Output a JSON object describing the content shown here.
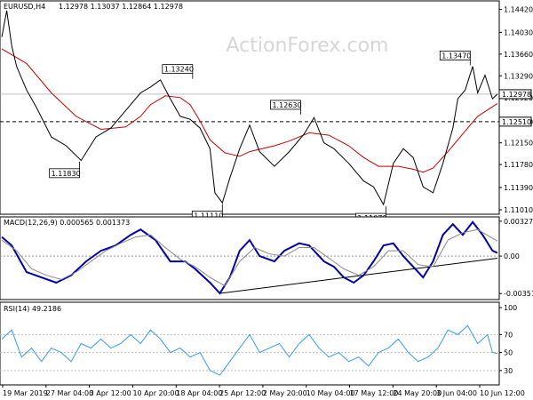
{
  "watermark": "ActionForex.com",
  "chart_data": [
    {
      "type": "candlestick",
      "title": "EURUSD,H4",
      "header_values": "1.12978 1.13037 1.12864 1.12978",
      "ylim": [
        1.1095,
        1.1455
      ],
      "y_ticks": [
        "1.14420",
        "1.14030",
        "1.13660",
        "1.13290",
        "1.12920",
        "1.12510",
        "1.12150",
        "1.11780",
        "1.11390",
        "1.11010"
      ],
      "y_tick_values": [
        1.1442,
        1.1403,
        1.1366,
        1.1329,
        1.1292,
        1.1251,
        1.1215,
        1.1178,
        1.1139,
        1.1101
      ],
      "current_price": "1.12978",
      "current_price_value": 1.12978,
      "level_line": "1.12510",
      "level_line_value": 1.1251,
      "annotations": [
        {
          "text": "1.13240",
          "x": 0.385,
          "value": 1.1324
        },
        {
          "text": "1.11830",
          "x": 0.157,
          "value": 1.1183
        },
        {
          "text": "1.12630",
          "x": 0.603,
          "value": 1.1263
        },
        {
          "text": "1.11110",
          "x": 0.445,
          "value": 1.1111
        },
        {
          "text": "1.11070",
          "x": 0.775,
          "value": 1.1107
        },
        {
          "text": "1.13470",
          "x": 0.945,
          "value": 1.1347
        }
      ],
      "series": [
        {
          "legend": false,
          "color": "#cc0000",
          "points": [
            [
              0,
              1.1375
            ],
            [
              0.05,
              1.135
            ],
            [
              0.1,
              1.13
            ],
            [
              0.15,
              1.126
            ],
            [
              0.2,
              1.1238
            ],
            [
              0.25,
              1.1242
            ],
            [
              0.28,
              1.126
            ],
            [
              0.3,
              1.128
            ],
            [
              0.33,
              1.1295
            ],
            [
              0.36,
              1.1292
            ],
            [
              0.38,
              1.128
            ],
            [
              0.4,
              1.1252
            ],
            [
              0.42,
              1.122
            ],
            [
              0.45,
              1.1198
            ],
            [
              0.48,
              1.1192
            ],
            [
              0.5,
              1.12
            ],
            [
              0.55,
              1.121
            ],
            [
              0.58,
              1.1218
            ],
            [
              0.62,
              1.1232
            ],
            [
              0.66,
              1.1228
            ],
            [
              0.7,
              1.121
            ],
            [
              0.73,
              1.119
            ],
            [
              0.76,
              1.1175
            ],
            [
              0.8,
              1.1175
            ],
            [
              0.83,
              1.117
            ],
            [
              0.85,
              1.1165
            ],
            [
              0.87,
              1.1172
            ],
            [
              0.9,
              1.12
            ],
            [
              0.93,
              1.123
            ],
            [
              0.96,
              1.126
            ],
            [
              1.0,
              1.1282
            ]
          ]
        },
        {
          "legend": false,
          "color": "#000000",
          "points": [
            [
              0,
              1.1395
            ],
            [
              0.01,
              1.144
            ],
            [
              0.02,
              1.138
            ],
            [
              0.03,
              1.1345
            ],
            [
              0.05,
              1.1305
            ],
            [
              0.07,
              1.1275
            ],
            [
              0.1,
              1.1225
            ],
            [
              0.13,
              1.121
            ],
            [
              0.16,
              1.1185
            ],
            [
              0.19,
              1.1225
            ],
            [
              0.22,
              1.124
            ],
            [
              0.25,
              1.127
            ],
            [
              0.28,
              1.13
            ],
            [
              0.3,
              1.131
            ],
            [
              0.32,
              1.1322
            ],
            [
              0.34,
              1.129
            ],
            [
              0.36,
              1.126
            ],
            [
              0.38,
              1.1255
            ],
            [
              0.4,
              1.124
            ],
            [
              0.42,
              1.1205
            ],
            [
              0.43,
              1.113
            ],
            [
              0.445,
              1.1113
            ],
            [
              0.46,
              1.1155
            ],
            [
              0.48,
              1.1205
            ],
            [
              0.5,
              1.1245
            ],
            [
              0.52,
              1.12
            ],
            [
              0.55,
              1.1175
            ],
            [
              0.58,
              1.12
            ],
            [
              0.61,
              1.123
            ],
            [
              0.63,
              1.1258
            ],
            [
              0.65,
              1.1215
            ],
            [
              0.67,
              1.1205
            ],
            [
              0.7,
              1.118
            ],
            [
              0.73,
              1.115
            ],
            [
              0.75,
              1.114
            ],
            [
              0.77,
              1.111
            ],
            [
              0.79,
              1.118
            ],
            [
              0.81,
              1.1205
            ],
            [
              0.83,
              1.119
            ],
            [
              0.85,
              1.114
            ],
            [
              0.87,
              1.113
            ],
            [
              0.89,
              1.118
            ],
            [
              0.91,
              1.124
            ],
            [
              0.92,
              1.129
            ],
            [
              0.935,
              1.1305
            ],
            [
              0.95,
              1.1345
            ],
            [
              0.96,
              1.13
            ],
            [
              0.975,
              1.133
            ],
            [
              0.99,
              1.129
            ],
            [
              1.0,
              1.1298
            ]
          ]
        }
      ]
    },
    {
      "type": "line",
      "title": "MACD(12,26,9) 0.000565 0.001373",
      "ylim": [
        -0.004,
        0.0036
      ],
      "y_ticks": [
        "0.003278",
        "0.00",
        "-0.003519"
      ],
      "y_tick_values": [
        0.003278,
        0.0,
        -0.003519
      ],
      "trendline": [
        [
          0.44,
          -0.0035
        ],
        [
          1.0,
          -0.0002
        ]
      ],
      "series": [
        {
          "color": "#0000aa",
          "points": [
            [
              0,
              0.0018
            ],
            [
              0.02,
              0.001
            ],
            [
              0.05,
              -0.0015
            ],
            [
              0.08,
              -0.002
            ],
            [
              0.11,
              -0.0025
            ],
            [
              0.14,
              -0.0018
            ],
            [
              0.17,
              -0.0005
            ],
            [
              0.2,
              0.0005
            ],
            [
              0.23,
              0.001
            ],
            [
              0.26,
              0.002
            ],
            [
              0.28,
              0.0025
            ],
            [
              0.31,
              0.0015
            ],
            [
              0.34,
              -0.0005
            ],
            [
              0.37,
              -0.0005
            ],
            [
              0.39,
              -0.0012
            ],
            [
              0.42,
              -0.0025
            ],
            [
              0.44,
              -0.0035
            ],
            [
              0.46,
              -0.002
            ],
            [
              0.48,
              0.0005
            ],
            [
              0.5,
              0.0015
            ],
            [
              0.52,
              0.0
            ],
            [
              0.55,
              -0.0005
            ],
            [
              0.57,
              0.0005
            ],
            [
              0.6,
              0.0012
            ],
            [
              0.62,
              0.001
            ],
            [
              0.65,
              -0.0005
            ],
            [
              0.67,
              -0.001
            ],
            [
              0.69,
              -0.002
            ],
            [
              0.71,
              -0.0025
            ],
            [
              0.73,
              -0.0018
            ],
            [
              0.75,
              -0.0005
            ],
            [
              0.77,
              0.001
            ],
            [
              0.79,
              0.0012
            ],
            [
              0.81,
              0.0
            ],
            [
              0.83,
              -0.001
            ],
            [
              0.85,
              -0.002
            ],
            [
              0.87,
              -0.0005
            ],
            [
              0.89,
              0.002
            ],
            [
              0.91,
              0.003
            ],
            [
              0.93,
              0.002
            ],
            [
              0.95,
              0.0032
            ],
            [
              0.97,
              0.002
            ],
            [
              0.99,
              0.0005
            ],
            [
              1.0,
              0.0003
            ]
          ]
        },
        {
          "color": "#888888",
          "points": [
            [
              0,
              0.0015
            ],
            [
              0.03,
              0.0005
            ],
            [
              0.06,
              -0.0012
            ],
            [
              0.09,
              -0.0018
            ],
            [
              0.12,
              -0.0022
            ],
            [
              0.15,
              -0.0015
            ],
            [
              0.18,
              -0.0005
            ],
            [
              0.21,
              0.0005
            ],
            [
              0.24,
              0.0012
            ],
            [
              0.27,
              0.0018
            ],
            [
              0.3,
              0.002
            ],
            [
              0.33,
              0.0008
            ],
            [
              0.36,
              -0.0003
            ],
            [
              0.39,
              -0.001
            ],
            [
              0.42,
              -0.002
            ],
            [
              0.45,
              -0.0028
            ],
            [
              0.48,
              -0.0005
            ],
            [
              0.51,
              0.0008
            ],
            [
              0.54,
              0.0002
            ],
            [
              0.57,
              0.0
            ],
            [
              0.6,
              0.0008
            ],
            [
              0.63,
              0.0008
            ],
            [
              0.66,
              -0.0002
            ],
            [
              0.69,
              -0.0012
            ],
            [
              0.72,
              -0.0018
            ],
            [
              0.75,
              -0.001
            ],
            [
              0.78,
              0.0005
            ],
            [
              0.81,
              0.0005
            ],
            [
              0.84,
              -0.0008
            ],
            [
              0.87,
              -0.001
            ],
            [
              0.9,
              0.0015
            ],
            [
              0.93,
              0.0022
            ],
            [
              0.96,
              0.0025
            ],
            [
              1.0,
              0.0014
            ]
          ]
        }
      ]
    },
    {
      "type": "line",
      "title": "RSI(14) 49.2186",
      "ylim": [
        15,
        105
      ],
      "y_ticks": [
        "100",
        "70",
        "50",
        "30"
      ],
      "y_tick_values": [
        100,
        70,
        50,
        30
      ],
      "series": [
        {
          "color": "#3399ff",
          "points": [
            [
              0,
              65
            ],
            [
              0.02,
              75
            ],
            [
              0.04,
              45
            ],
            [
              0.06,
              55
            ],
            [
              0.08,
              40
            ],
            [
              0.1,
              55
            ],
            [
              0.12,
              50
            ],
            [
              0.14,
              40
            ],
            [
              0.16,
              60
            ],
            [
              0.18,
              55
            ],
            [
              0.2,
              65
            ],
            [
              0.22,
              55
            ],
            [
              0.24,
              60
            ],
            [
              0.26,
              70
            ],
            [
              0.28,
              60
            ],
            [
              0.3,
              75
            ],
            [
              0.32,
              65
            ],
            [
              0.34,
              50
            ],
            [
              0.36,
              55
            ],
            [
              0.38,
              45
            ],
            [
              0.4,
              50
            ],
            [
              0.42,
              30
            ],
            [
              0.44,
              25
            ],
            [
              0.46,
              40
            ],
            [
              0.48,
              55
            ],
            [
              0.5,
              70
            ],
            [
              0.52,
              50
            ],
            [
              0.54,
              55
            ],
            [
              0.56,
              60
            ],
            [
              0.58,
              45
            ],
            [
              0.6,
              60
            ],
            [
              0.62,
              70
            ],
            [
              0.64,
              55
            ],
            [
              0.66,
              45
            ],
            [
              0.68,
              50
            ],
            [
              0.7,
              40
            ],
            [
              0.72,
              45
            ],
            [
              0.74,
              35
            ],
            [
              0.76,
              50
            ],
            [
              0.78,
              55
            ],
            [
              0.8,
              65
            ],
            [
              0.82,
              50
            ],
            [
              0.84,
              40
            ],
            [
              0.86,
              45
            ],
            [
              0.88,
              55
            ],
            [
              0.9,
              75
            ],
            [
              0.92,
              70
            ],
            [
              0.94,
              80
            ],
            [
              0.96,
              60
            ],
            [
              0.98,
              70
            ],
            [
              0.99,
              50
            ],
            [
              1.0,
              49
            ]
          ]
        }
      ]
    }
  ],
  "x_labels": [
    "19 Mar 2019",
    "27 Mar 04:00",
    "3 Apr 12:00",
    "10 Apr 20:00",
    "18 Apr 04:00",
    "25 Apr 12:00",
    "2 May 20:00",
    "10 May 04:00",
    "17 May 12:00",
    "24 May 20:00",
    "3 Jun 04:00",
    "10 Jun 12:00"
  ]
}
